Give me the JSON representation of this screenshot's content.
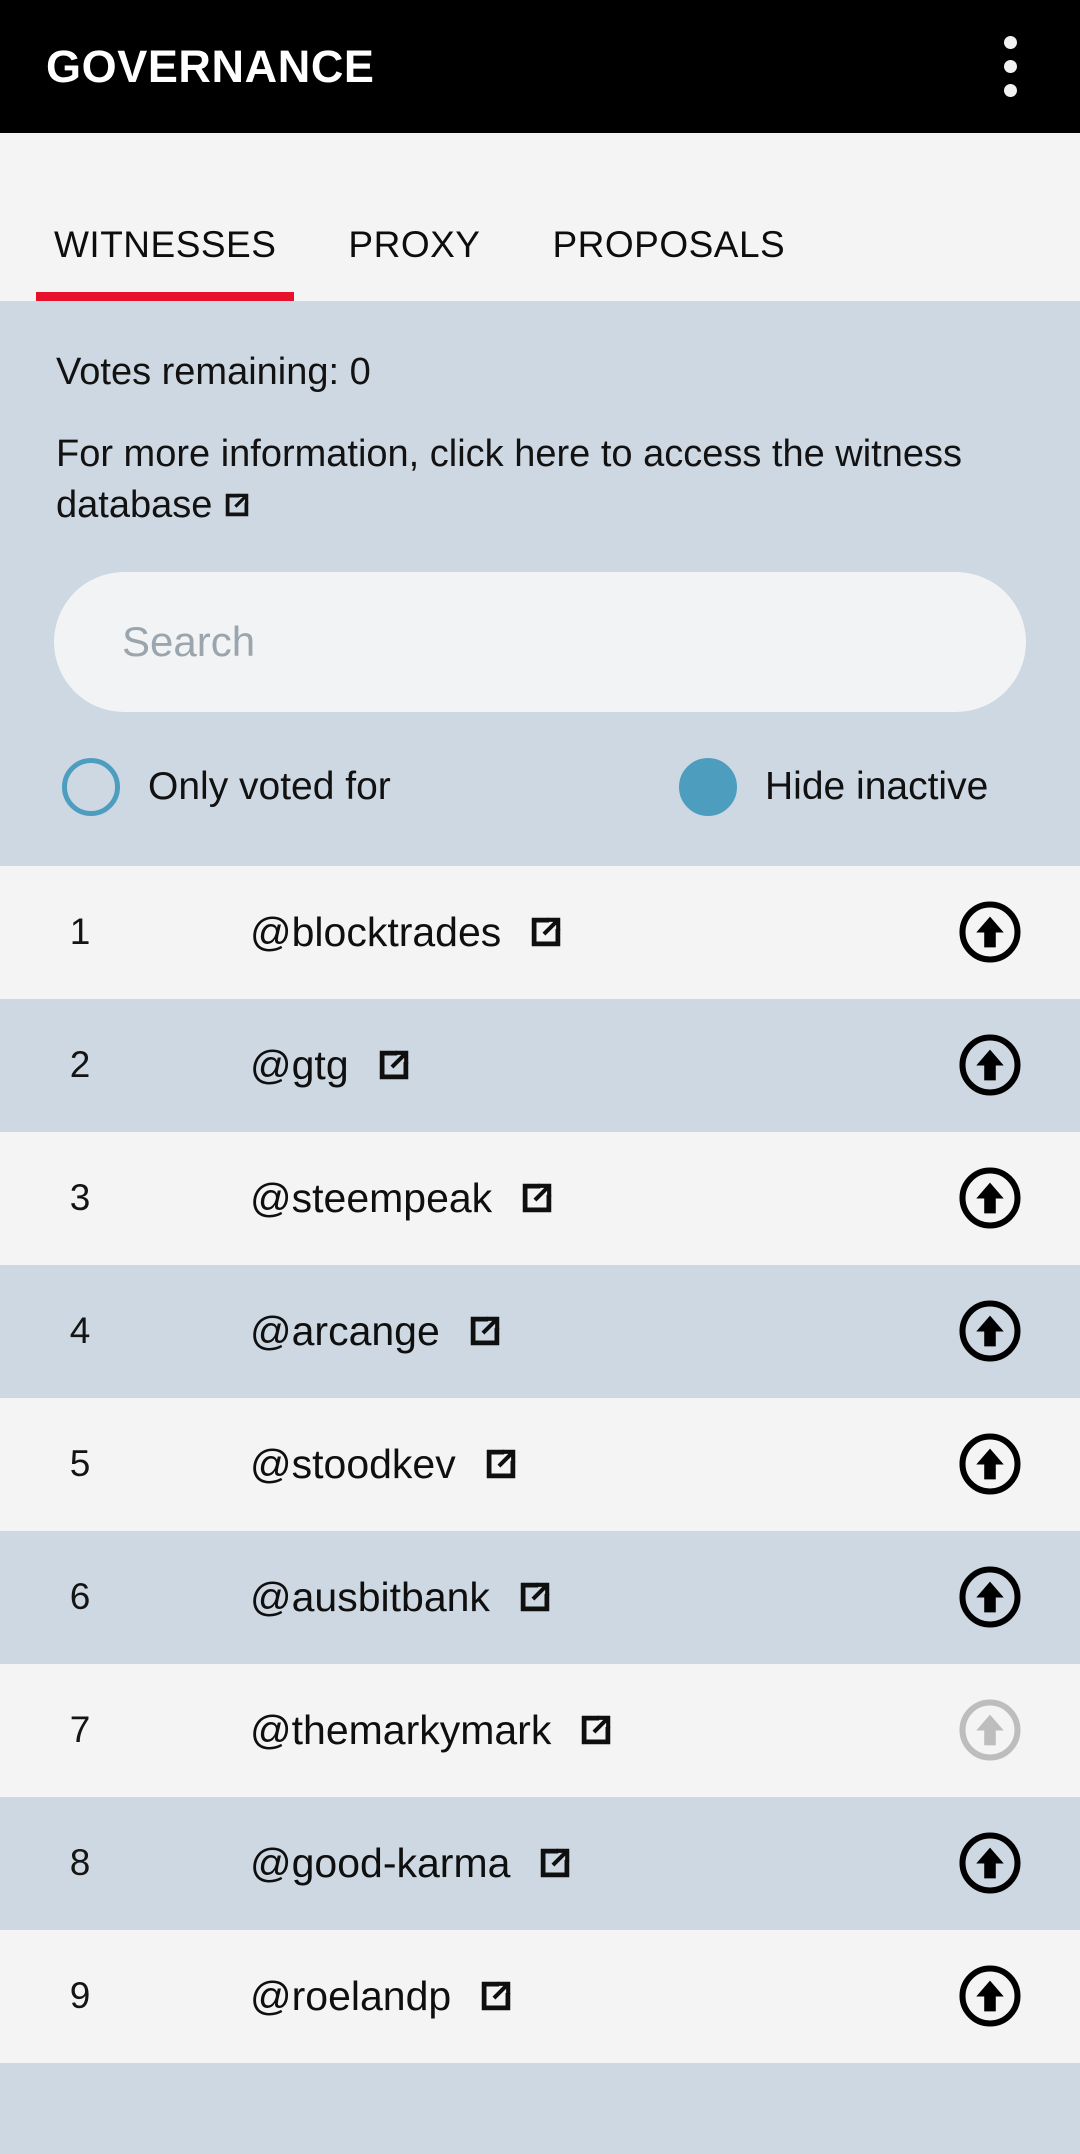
{
  "appbar": {
    "title": "GOVERNANCE",
    "menu_icon": "overflow-menu-icon"
  },
  "tabs": [
    {
      "label": "WITNESSES",
      "active": true
    },
    {
      "label": "PROXY",
      "active": false
    },
    {
      "label": "PROPOSALS",
      "active": false
    }
  ],
  "info": {
    "votes_remaining_label": "Votes remaining: 0",
    "database_text": "For more information, click here to access the witness database",
    "database_link_icon": "external-link-icon"
  },
  "search": {
    "value": "",
    "placeholder": "Search"
  },
  "filters": [
    {
      "label": "Only voted for",
      "checked": false
    },
    {
      "label": "Hide inactive",
      "checked": true
    }
  ],
  "colors": {
    "appbar_background": "#000000",
    "tabbar_background": "#f4f4f4",
    "active_tab_indicator": "#e8112d",
    "panel_background": "#ced8e2",
    "row_odd_background": "#f4f4f4",
    "row_even_background": "#ced8e2",
    "toggle_accent": "#4d9dbf",
    "vote_enabled": "#000000",
    "vote_disabled": "#bdbdbd"
  },
  "witnesses": [
    {
      "rank": "1",
      "name": "@blocktrades",
      "vote_enabled": true
    },
    {
      "rank": "2",
      "name": "@gtg",
      "vote_enabled": true
    },
    {
      "rank": "3",
      "name": "@steempeak",
      "vote_enabled": true
    },
    {
      "rank": "4",
      "name": "@arcange",
      "vote_enabled": true
    },
    {
      "rank": "5",
      "name": "@stoodkev",
      "vote_enabled": true
    },
    {
      "rank": "6",
      "name": "@ausbitbank",
      "vote_enabled": true
    },
    {
      "rank": "7",
      "name": "@themarkymark",
      "vote_enabled": false
    },
    {
      "rank": "8",
      "name": "@good-karma",
      "vote_enabled": true
    },
    {
      "rank": "9",
      "name": "@roelandp",
      "vote_enabled": true
    }
  ]
}
